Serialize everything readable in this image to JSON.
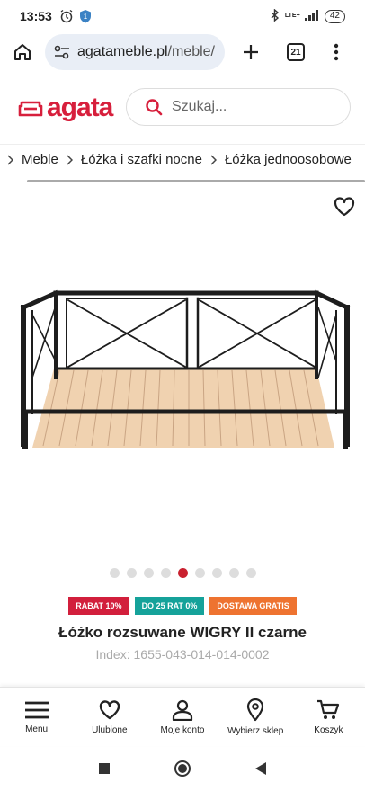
{
  "status": {
    "time": "13:53",
    "network": "LTE+",
    "battery": "42"
  },
  "browser": {
    "url_domain": "agatameble.pl",
    "url_path": "/meble/",
    "tab_count": "21"
  },
  "site": {
    "logo": "agata",
    "search_placeholder": "Szukaj..."
  },
  "breadcrumb": [
    "Meble",
    "Łóżka i szafki nocne",
    "Łóżka jednoosobowe"
  ],
  "product": {
    "badges": [
      "RABAT 10%",
      "DO 25 RAT 0%",
      "DOSTAWA GRATIS"
    ],
    "title": "Łóżko rozsuwane WIGRY II czarne",
    "index": "Index: 1655-043-014-014-0002"
  },
  "gallery": {
    "count": 9,
    "active": 4
  },
  "bottom_nav": {
    "menu": "Menu",
    "favorites": "Ulubione",
    "account": "Moje konto",
    "store": "Wybierz sklep",
    "cart": "Koszyk"
  },
  "colors": {
    "brand": "#d71f3c",
    "badge_teal": "#15a29a",
    "badge_orange": "#ee7330"
  }
}
